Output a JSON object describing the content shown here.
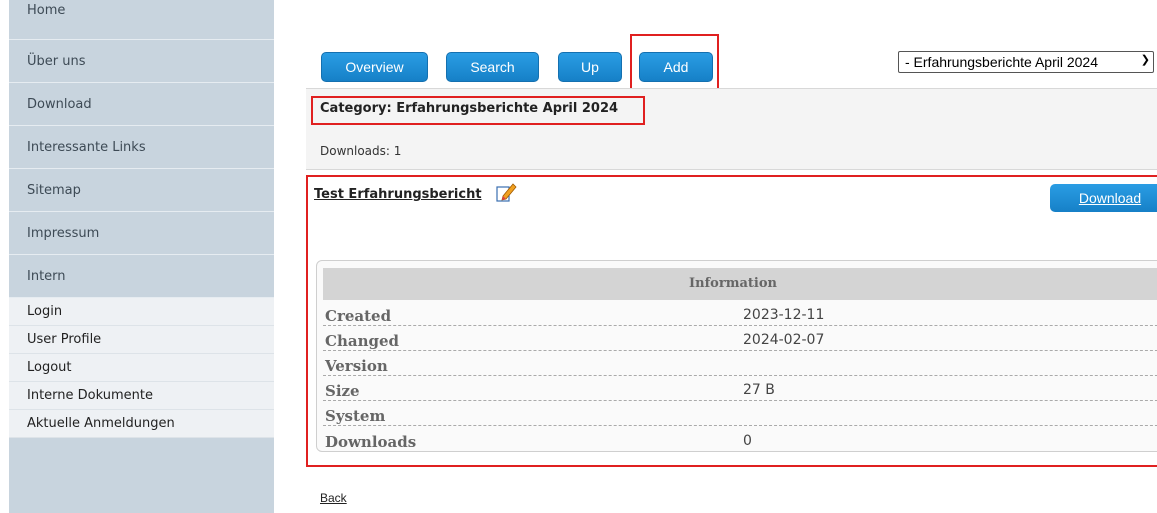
{
  "sidebar": {
    "main_items": [
      "Home",
      "Über uns",
      "Download",
      "Interessante Links",
      "Sitemap",
      "Impressum",
      "Intern"
    ],
    "sub_items": [
      "Login",
      "User Profile",
      "Logout",
      "Interne Dokumente",
      "Aktuelle Anmeldungen"
    ]
  },
  "toolbar": {
    "overview": "Overview",
    "search": "Search",
    "up": "Up",
    "add": "Add"
  },
  "category_select": {
    "selected": "- Erfahrungsberichte April 2024"
  },
  "category": {
    "title": "Category: Erfahrungsberichte April 2024",
    "downloads_count": "Downloads: 1"
  },
  "entry": {
    "title": "Test Erfahrungsbericht",
    "download_button": "Download",
    "info_header": "Information",
    "info_rows": [
      {
        "label": "Created",
        "value": "2023-12-11"
      },
      {
        "label": "Changed",
        "value": "2024-02-07"
      },
      {
        "label": "Version",
        "value": ""
      },
      {
        "label": "Size",
        "value": "27 B"
      },
      {
        "label": "System",
        "value": ""
      },
      {
        "label": "Downloads",
        "value": "0"
      }
    ]
  },
  "back_link": "Back",
  "colors": {
    "button_blue": "#1e8fd6",
    "highlight_red": "#e02020",
    "sidebar_bg": "#c8d4de"
  }
}
